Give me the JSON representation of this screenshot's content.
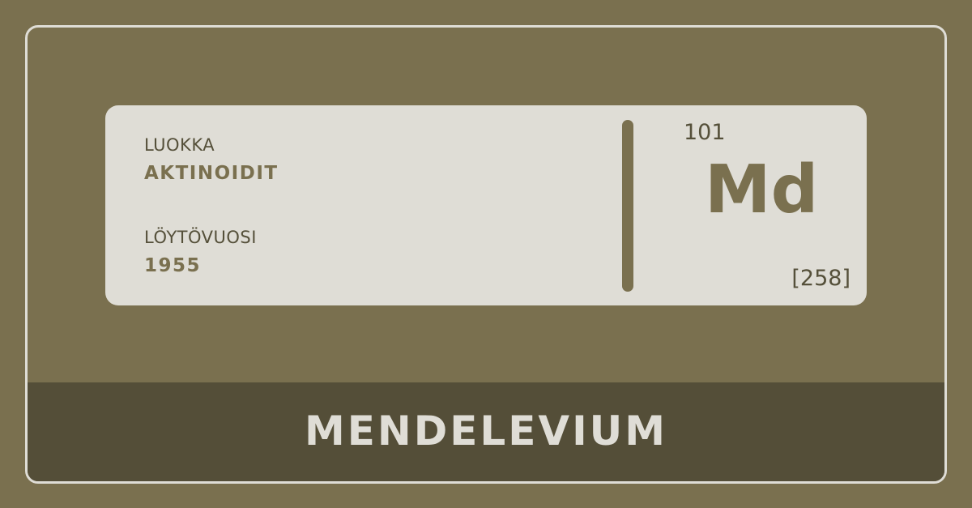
{
  "card": {
    "category_label": "LUOKKA",
    "category_value": "AKTINOIDIT",
    "year_label": "LÖYTÖVUOSI",
    "year_value": "1955",
    "atomic_number": "101",
    "symbol": "Md",
    "atomic_mass": "[258]"
  },
  "element_name": "MENDELEVIUM",
  "colors": {
    "background": "#7a704f",
    "card": "#dfddd6",
    "band": "#544e38",
    "text_dark": "#55503a"
  }
}
